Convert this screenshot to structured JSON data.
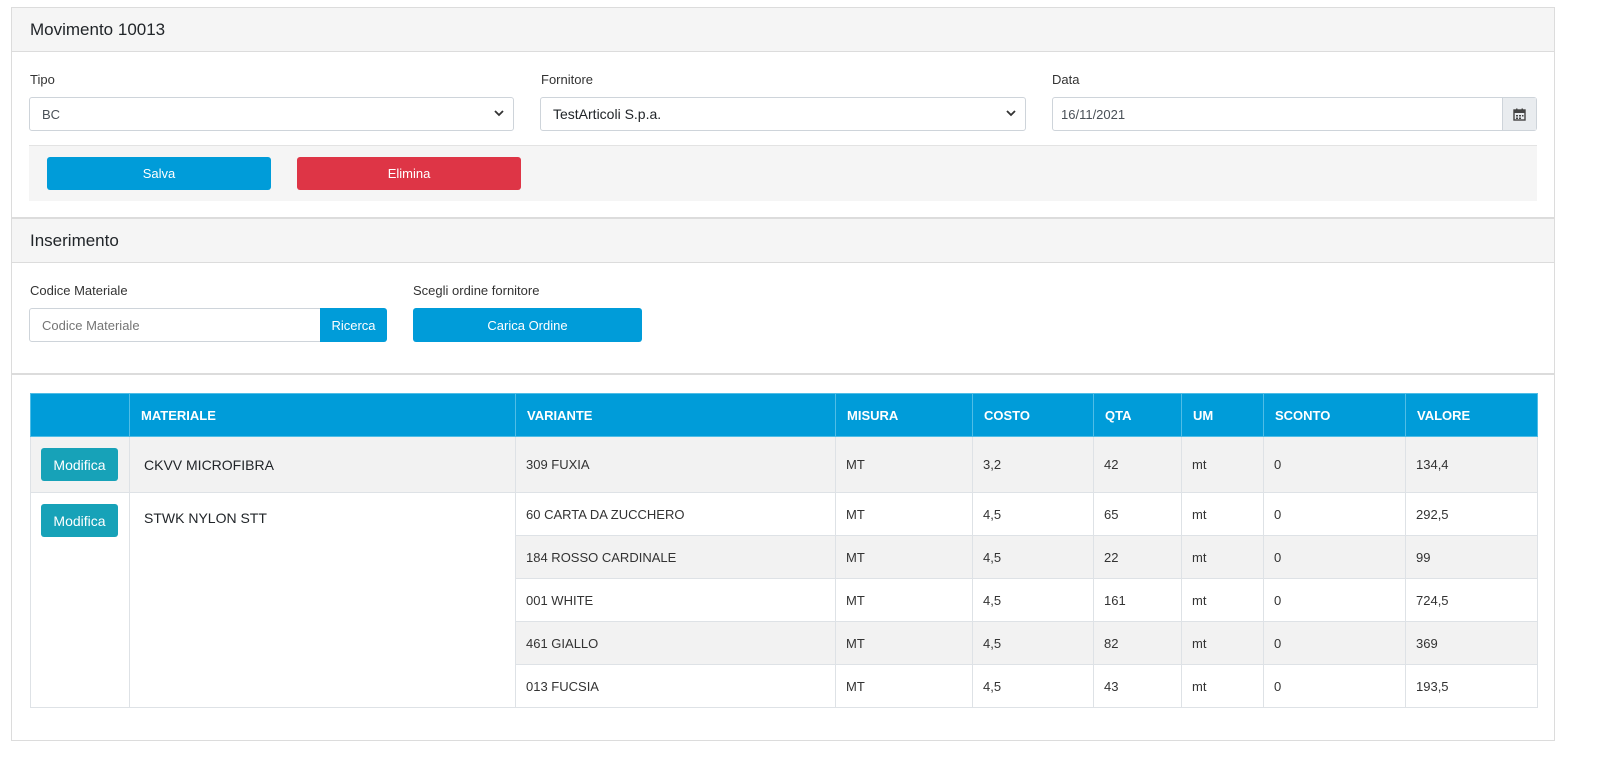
{
  "movimento": {
    "title": "Movimento 10013",
    "tipo_label": "Tipo",
    "tipo_value": "BC",
    "fornitore_label": "Fornitore",
    "fornitore_value": "TestArticoli S.p.a.",
    "data_label": "Data",
    "data_value": "16/11/2021",
    "save_label": "Salva",
    "delete_label": "Elimina"
  },
  "inserimento": {
    "title": "Inserimento",
    "codice_label": "Codice Materiale",
    "codice_placeholder": "Codice Materiale",
    "search_label": "Ricerca",
    "ordine_label": "Scegli ordine fornitore",
    "carica_label": "Carica Ordine"
  },
  "table": {
    "headers": [
      "",
      "MATERIALE",
      "VARIANTE",
      "MISURA",
      "COSTO",
      "QTA",
      "UM",
      "SCONTO",
      "VALORE"
    ],
    "edit_label": "Modifica",
    "groups": [
      {
        "materiale": "CKVV MICROFIBRA",
        "rows": [
          {
            "variante": "309 FUXIA",
            "misura": "MT",
            "costo": "3,2",
            "qta": "42",
            "um": "mt",
            "sconto": "0",
            "valore": "134,4"
          }
        ]
      },
      {
        "materiale": "STWK NYLON STT",
        "rows": [
          {
            "variante": "60 CARTA DA ZUCCHERO",
            "misura": "MT",
            "costo": "4,5",
            "qta": "65",
            "um": "mt",
            "sconto": "0",
            "valore": "292,5"
          },
          {
            "variante": "184 ROSSO CARDINALE",
            "misura": "MT",
            "costo": "4,5",
            "qta": "22",
            "um": "mt",
            "sconto": "0",
            "valore": "99"
          },
          {
            "variante": "001 WHITE",
            "misura": "MT",
            "costo": "4,5",
            "qta": "161",
            "um": "mt",
            "sconto": "0",
            "valore": "724,5"
          },
          {
            "variante": "461 GIALLO",
            "misura": "MT",
            "costo": "4,5",
            "qta": "82",
            "um": "mt",
            "sconto": "0",
            "valore": "369"
          },
          {
            "variante": "013 FUCSIA",
            "misura": "MT",
            "costo": "4,5",
            "qta": "43",
            "um": "mt",
            "sconto": "0",
            "valore": "193,5"
          }
        ]
      }
    ]
  },
  "icons": {
    "select": "chevron-down-icon",
    "date": "calendar-icon"
  },
  "colors": {
    "primary": "#009cd9",
    "danger": "#de3546",
    "info": "#17a2b8"
  }
}
